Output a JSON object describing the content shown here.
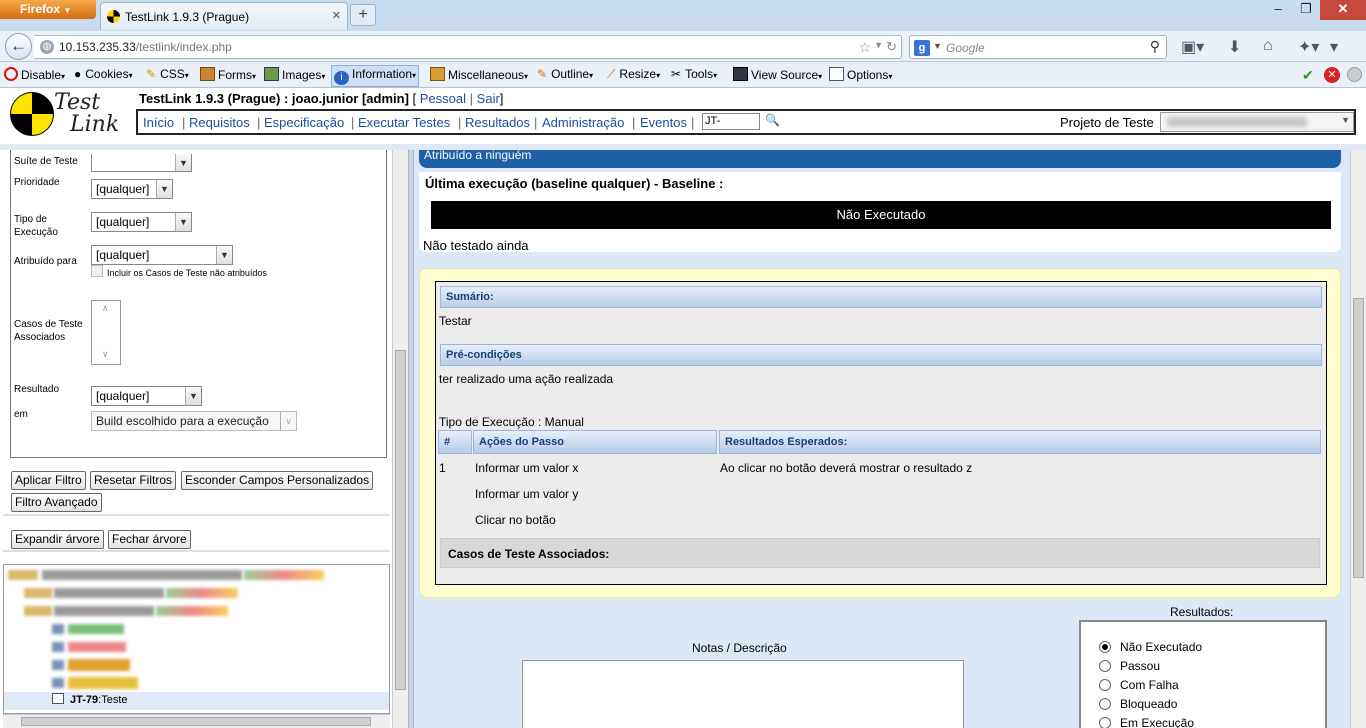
{
  "browser": {
    "menu_button": "Firefox",
    "tab_title": "TestLink 1.9.3 (Prague)",
    "tab_close": "✕",
    "new_tab": "+",
    "url_host": "10.153.235.33",
    "url_path": "/testlink/index.php",
    "search_placeholder": "Google",
    "window_controls": {
      "minimize": "–",
      "restore": "❐",
      "close": "✕"
    }
  },
  "webdev_toolbar": {
    "items": [
      "Disable",
      "Cookies",
      "CSS",
      "Forms",
      "Images",
      "Information",
      "Miscellaneous",
      "Outline",
      "Resize",
      "Tools",
      "View Source",
      "Options"
    ]
  },
  "header": {
    "title_main": "TestLink 1.9.3 (Prague) : joao.junior [admin]",
    "title_bracket_open": "[",
    "link_personal": "Pessoal",
    "link_sep": "|",
    "link_logout": "Sair",
    "title_bracket_close": "]",
    "logo_line1": "Test",
    "logo_line2": "Link",
    "menu": [
      "Início",
      "Requisitos",
      "Especificação",
      "Executar Testes",
      "Resultados",
      "Administração",
      "Eventos"
    ],
    "menu_separator": "|",
    "tc_search_value": "JT-",
    "project_label": "Projeto de Teste"
  },
  "filters": {
    "suite_label": "Suíte de Teste",
    "priority_label": "Prioridade",
    "priority_value": "[qualquer]",
    "exec_type_label": "Tipo de Execução",
    "exec_type_value": "[qualquer]",
    "assigned_label": "Atribuído para",
    "assigned_value": "[qualquer]",
    "include_unassigned": "Incluir os Casos de Teste não atribuídos",
    "linked_cases_label": "Casos de Teste Associados",
    "result_label": "Resultado",
    "result_value": "[qualquer]",
    "in_label": "em",
    "in_value": "Build escolhido para a execução",
    "btn_apply": "Aplicar Filtro",
    "btn_reset": "Resetar Filtros",
    "btn_hide_custom": "Esconder Campos Personalizados",
    "btn_advanced": "Filtro Avançado",
    "btn_expand": "Expandir árvore",
    "btn_collapse": "Fechar árvore"
  },
  "tree": {
    "selected_id": "JT-79",
    "selected_name": ":Teste"
  },
  "execution": {
    "assigned_bar": "Atribuído a ninguém",
    "last_exec_title": "Última execução (baseline qualquer) - Baseline :",
    "status": "Não Executado",
    "note": "Não testado ainda"
  },
  "spec": {
    "summary_head": "Sumário:",
    "summary_text": "Testar",
    "precond_head": "Pré-condições",
    "precond_text": "ter realizado uma ação realizada",
    "exec_type_line": "Tipo de Execução : Manual",
    "col_num": "#",
    "col_actions": "Ações do Passo",
    "col_expected": "Resultados Esperados:",
    "steps": [
      {
        "num": "1",
        "action": "Informar um valor x",
        "expected": "Ao clicar no botão deverá mostrar o resultado z"
      },
      {
        "num": "",
        "action": "Informar um valor y",
        "expected": ""
      },
      {
        "num": "",
        "action": "Clicar no botão",
        "expected": ""
      }
    ],
    "assoc_head": "Casos de Teste Associados:"
  },
  "result_form": {
    "notes_label": "Notas / Descrição",
    "results_label": "Resultados:",
    "options": [
      "Não Executado",
      "Passou",
      "Com Falha",
      "Bloqueado",
      "Em Execução"
    ],
    "selected_index": 0
  },
  "colors": {
    "assigned_bar": "#1f5fa6",
    "panel_yellow": "#ffffd2",
    "link_blue": "#1a4f9c"
  }
}
